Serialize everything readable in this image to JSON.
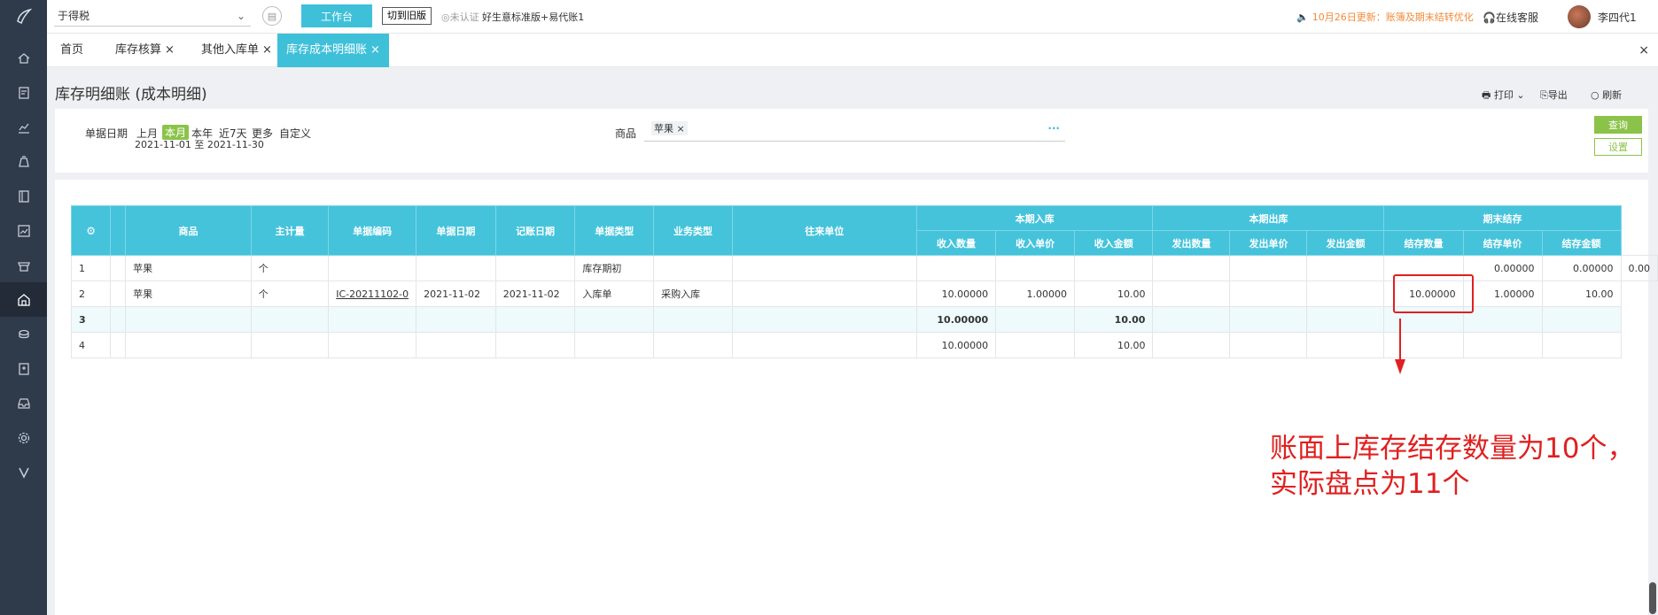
{
  "topbar": {
    "company": "于得税",
    "workbench": "工作台",
    "switch_old": "切到旧版",
    "unverified": "未认证",
    "edition": "好生意标准版+易代账1",
    "notice": "10月26日更新：账簿及期末结转优化",
    "service": "在线客服",
    "user": "李四代1"
  },
  "tabs": [
    "首页",
    "库存核算",
    "其他入库单",
    "库存成本明细账"
  ],
  "page": {
    "title": "库存明细账 (成本明细)",
    "print": "打印",
    "export": "导出",
    "refresh": "刷新"
  },
  "filter": {
    "date_label": "单据日期",
    "quick": [
      "上月",
      "本月",
      "本年",
      "近7天",
      "更多",
      "自定义"
    ],
    "date_range": "2021-11-01 至 2021-11-30",
    "goods_label": "商品",
    "goods_tag": "苹果",
    "goods_more": "···",
    "query": "查询",
    "setting": "设置"
  },
  "table": {
    "headers": [
      "商品",
      "主计量",
      "单据编码",
      "单据日期",
      "记账日期",
      "单据类型",
      "业务类型",
      "往来单位"
    ],
    "groups": [
      "本期入库",
      "本期出库",
      "期末结存"
    ],
    "sub_headers": [
      "收入数量",
      "收入单价",
      "收入金额",
      "发出数量",
      "发出单价",
      "发出金额",
      "结存数量",
      "结存单价",
      "结存金额"
    ],
    "rows": [
      [
        "1",
        "苹果",
        "个",
        "",
        "",
        "",
        "库存期初",
        "",
        "",
        "",
        "",
        "",
        "",
        "",
        "",
        "",
        "0.00000",
        "0.00000",
        "0.00"
      ],
      [
        "2",
        "苹果",
        "个",
        "IC-20211102-0",
        "2021-11-02",
        "2021-11-02",
        "入库单",
        "采购入库",
        "",
        "10.00000",
        "1.00000",
        "10.00",
        "",
        "",
        "",
        "10.00000",
        "1.00000",
        "10.00"
      ],
      [
        "3",
        "",
        "",
        "",
        "",
        "",
        "",
        "",
        "",
        "10.00000",
        "",
        "10.00",
        "",
        "",
        "",
        "",
        "",
        ""
      ],
      [
        "4",
        "",
        "",
        "",
        "",
        "",
        "",
        "",
        "",
        "10.00000",
        "",
        "10.00",
        "",
        "",
        "",
        "",
        "",
        ""
      ]
    ]
  },
  "annotation": "账面上库存结存数量为10个，实际盘点为11个",
  "colors": {
    "accent": "#44c3db",
    "green": "#8bc34a",
    "red": "#e02020"
  }
}
